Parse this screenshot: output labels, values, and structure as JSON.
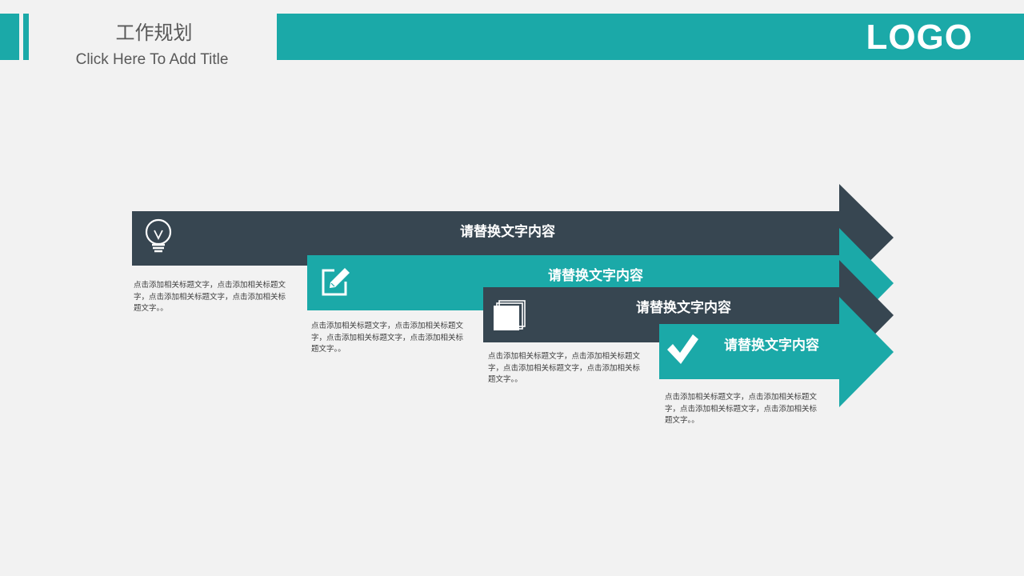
{
  "header": {
    "title": "工作规划",
    "subtitle": "Click  Here  To Add  Title",
    "logo": "LOGO"
  },
  "colors": {
    "teal": "#1ba9a8",
    "dark": "#374651",
    "background": "#f2f2f2",
    "white": "#ffffff"
  },
  "steps": [
    {
      "title": "请替换文字内容",
      "icon": "lightbulb-icon",
      "color": "dark",
      "description": "点击添加相关标题文字，点击添加相关标题文字，点击添加相关标题文字，点击添加相关标题文字。。"
    },
    {
      "title": "请替换文字内容",
      "icon": "edit-icon",
      "color": "teal",
      "description": "点击添加相关标题文字，点击添加相关标题文字，点击添加相关标题文字，点击添加相关标题文字。。"
    },
    {
      "title": "请替换文字内容",
      "icon": "documents-icon",
      "color": "dark",
      "description": "点击添加相关标题文字，点击添加相关标题文字，点击添加相关标题文字，点击添加相关标题文字。。"
    },
    {
      "title": "请替换文字内容",
      "icon": "checkmark-icon",
      "color": "teal",
      "description": "点击添加相关标题文字，点击添加相关标题文字，点击添加相关标题文字，点击添加相关标题文字。。"
    }
  ]
}
